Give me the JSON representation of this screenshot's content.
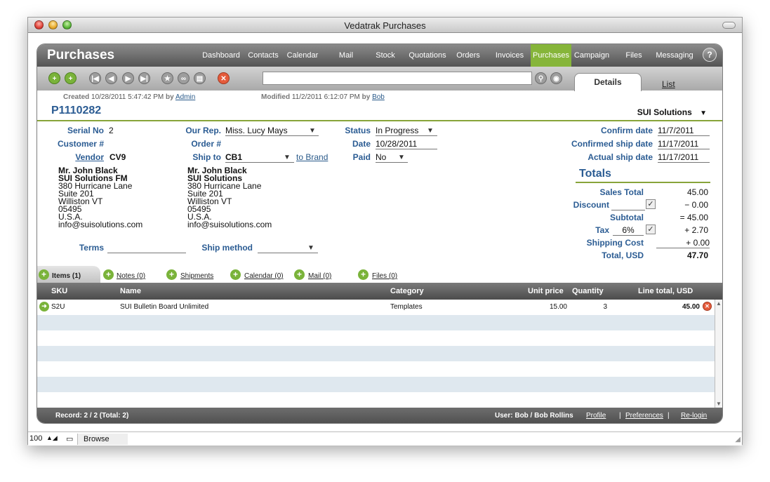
{
  "window": {
    "title": "Vedatrak Purchases"
  },
  "header": {
    "app_title": "Purchases",
    "nav": [
      "Dashboard",
      "Contacts",
      "Calendar",
      "Mail",
      "Stock",
      "Quotations",
      "Orders",
      "Invoices",
      "Purchases",
      "Campaign",
      "Files",
      "Messaging"
    ],
    "active_nav": "Purchases",
    "help": "?"
  },
  "tabs": {
    "details": "Details",
    "list": "List"
  },
  "search": {
    "value": ""
  },
  "meta": {
    "created_label": "Created",
    "created_value": "10/28/2011 5:47:42 PM",
    "created_by_label": "by",
    "created_by": "Admin",
    "modified_label": "Modified",
    "modified_value": "11/2/2011 6:12:07 PM",
    "modified_by_label": "by",
    "modified_by": "Bob"
  },
  "record": {
    "id": "P1110282",
    "company": "SUI Solutions"
  },
  "form": {
    "serial_no_label": "Serial No",
    "serial_no": "2",
    "customer_label": "Customer #",
    "vendor_label": "Vendor",
    "vendor": "CV9",
    "our_rep_label": "Our Rep.",
    "our_rep": "Miss. Lucy Mays",
    "order_label": "Order #",
    "ship_to_label": "Ship to",
    "ship_to": "CB1",
    "to_brand": "to Brand",
    "status_label": "Status",
    "status": "In Progress",
    "date_label": "Date",
    "date": "10/28/2011",
    "paid_label": "Paid",
    "paid": "No",
    "confirm_date_label": "Confirm date",
    "confirm_date": "11/7/2011",
    "confirmed_ship_label": "Confirmed ship date",
    "confirmed_ship": "11/17/2011",
    "actual_ship_label": "Actual ship date",
    "actual_ship": "11/17/2011",
    "terms_label": "Terms",
    "terms": "",
    "ship_method_label": "Ship method",
    "ship_method": ""
  },
  "vendor_address": {
    "name": "Mr. John Black",
    "company": "SUI Solutions FM",
    "line1": "380 Hurricane Lane",
    "line2": "Suite 201",
    "city": "Williston VT",
    "zip": "05495",
    "country": "U.S.A.",
    "email": "info@suisolutions.com"
  },
  "ship_address": {
    "name": "Mr. John Black",
    "company": "SUI Solutions",
    "line1": "380 Hurricane Lane",
    "line2": "Suite 201",
    "city": "Williston VT",
    "zip": "05495",
    "country": "U.S.A.",
    "email": "info@suisolutions.com"
  },
  "totals": {
    "title": "Totals",
    "sales_total_label": "Sales Total",
    "sales_total": "45.00",
    "discount_label": "Discount",
    "discount": "− 0.00",
    "subtotal_label": "Subtotal",
    "subtotal": "= 45.00",
    "tax_label": "Tax",
    "tax_rate": "6%",
    "tax": "+ 2.70",
    "shipping_label": "Shipping Cost",
    "shipping": "+ 0.00",
    "total_label": "Total, USD",
    "total": "47.70"
  },
  "subtabs": [
    "Items (1)",
    "Notes (0)",
    "Shipments",
    "Calendar (0)",
    "Mail (0)",
    "Files (0)"
  ],
  "table": {
    "headers": [
      "SKU",
      "Name",
      "Category",
      "Unit price",
      "Quantity",
      "Line total, USD"
    ],
    "rows": [
      {
        "sku": "S2U",
        "name": "SUI Bulletin Board Unlimited",
        "category": "Templates",
        "unit_price": "15.00",
        "quantity": "3",
        "line_total": "45.00"
      }
    ]
  },
  "footer": {
    "record": "Record: 2 / 2 (Total: 2)",
    "user": "User: Bob / Bob Rollins",
    "profile": "Profile",
    "sep1": "|",
    "preferences": "Preferences",
    "sep2": "|",
    "relogin": "Re-login"
  },
  "statusbar": {
    "zoom": "100",
    "mode": "Browse"
  },
  "colors": {
    "accent": "#86b53a",
    "label": "#2b5c93",
    "row_alt": "#dfe8ef"
  }
}
